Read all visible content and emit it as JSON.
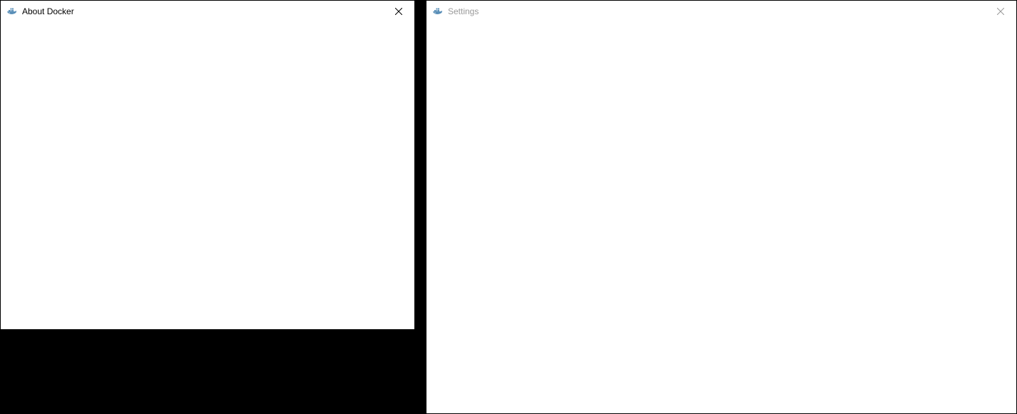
{
  "windows": {
    "about": {
      "title": "About Docker",
      "active": true
    },
    "settings": {
      "title": "Settings",
      "active": false
    }
  }
}
